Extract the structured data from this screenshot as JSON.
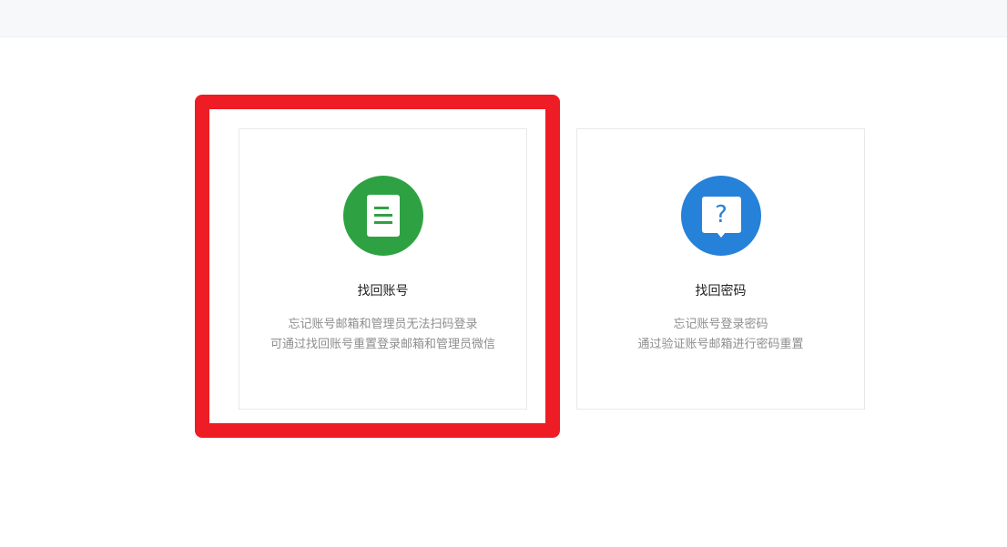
{
  "colors": {
    "account_icon_bg": "#2ea243",
    "password_icon_bg": "#2681d9",
    "highlight": "#ee1c25"
  },
  "cards": [
    {
      "icon": "document-icon",
      "title": "找回账号",
      "desc": [
        "忘记账号邮箱和管理员无法扫码登录",
        "可通过找回账号重置登录邮箱和管理员微信"
      ]
    },
    {
      "icon": "question-icon",
      "title": "找回密码",
      "desc": [
        "忘记账号登录密码",
        "通过验证账号邮箱进行密码重置"
      ]
    }
  ]
}
